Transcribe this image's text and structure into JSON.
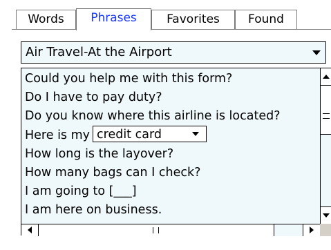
{
  "tabs": [
    {
      "label": "Words",
      "active": false
    },
    {
      "label": "Phrases",
      "active": true
    },
    {
      "label": "Favorites",
      "active": false
    },
    {
      "label": "Found",
      "active": false
    }
  ],
  "category": {
    "selected": "Air Travel-At the Airport"
  },
  "phrases": {
    "items": [
      "Could you help me with this form?",
      "Do I have to pay duty?",
      "Do you know where this airline is located?",
      "Here is my",
      "How long is the layover?",
      "How many bags can I check?",
      "I am going to [___]",
      "I am here on business."
    ],
    "inline_select_value": "credit card"
  },
  "colors": {
    "active_tab_text": "#1a39ff",
    "list_background": "#eff9fb"
  }
}
